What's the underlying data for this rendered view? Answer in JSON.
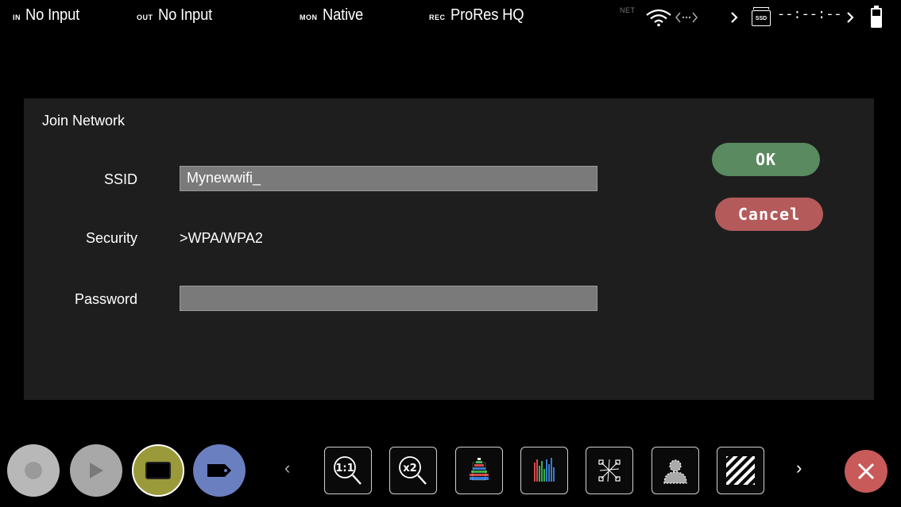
{
  "status": {
    "in_tag": "IN",
    "in_value": "No Input",
    "out_tag": "OUT",
    "out_value": "No Input",
    "mon_tag": "MON",
    "mon_value": "Native",
    "rec_tag": "REC",
    "rec_value": "ProRes HQ",
    "net_tag": "NET",
    "ssd_label": "SSD",
    "timecode": "--:--:--"
  },
  "dialog": {
    "title": "Join Network",
    "ssid_label": "SSID",
    "ssid_value": "Mynewwifi_",
    "security_label": "Security",
    "security_value": ">WPA/WPA2",
    "password_label": "Password",
    "password_value": "",
    "ok_label": "OK",
    "cancel_label": "Cancel"
  },
  "toolbar": {
    "zoom_1_1": "1:1",
    "zoom_x2": "x2",
    "prev_chevron": "‹",
    "next_chevron": "›"
  },
  "colors": {
    "ok": "#5a8a5f",
    "cancel": "#b45a5a",
    "monitor_btn": "#9a9a3a",
    "tag_btn": "#6a7fbf",
    "close": "#c85a5a"
  }
}
